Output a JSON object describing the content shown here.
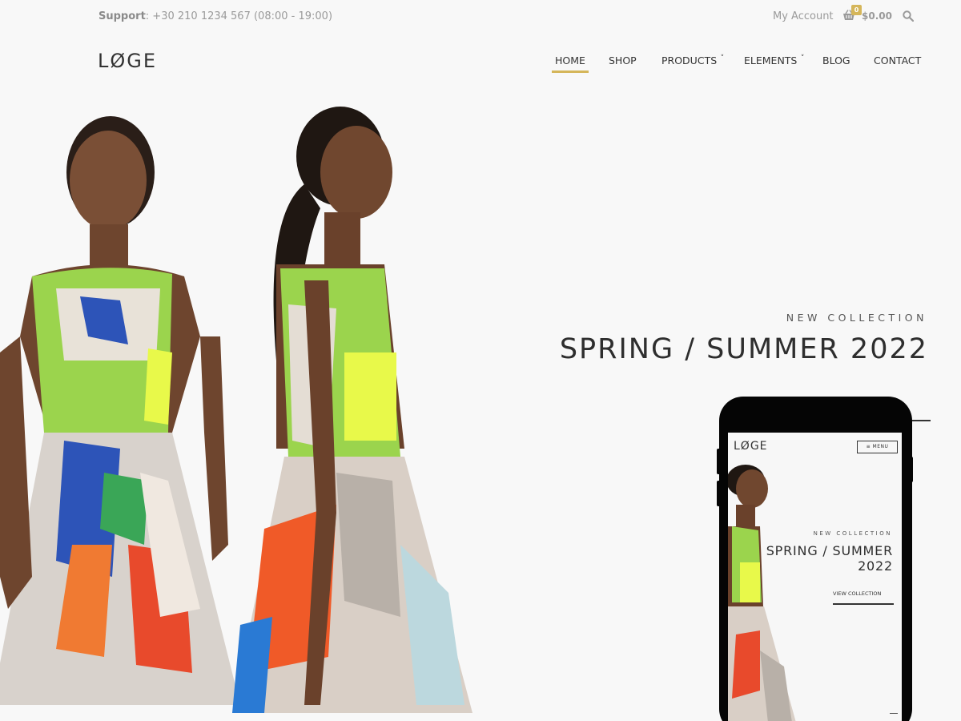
{
  "topbar": {
    "support_label": "Support",
    "support_text": ": +30 210 1234 567 (08:00 - 19:00)",
    "account_label": "My Account",
    "cart_count": "0",
    "cart_total": "$0.00"
  },
  "header": {
    "logo": "LØGE",
    "nav": [
      {
        "label": "HOME",
        "active": true
      },
      {
        "label": "SHOP"
      },
      {
        "label": "PRODUCTS",
        "dropdown": true
      },
      {
        "label": "ELEMENTS",
        "dropdown": true
      },
      {
        "label": "BLOG"
      },
      {
        "label": "CONTACT"
      }
    ]
  },
  "hero": {
    "eyebrow": "NEW COLLECTION",
    "headline": "SPRING / SUMMER 2022"
  },
  "mobile_preview": {
    "logo": "LØGE",
    "menu_label": "≡ MENU",
    "eyebrow": "NEW COLLECTION",
    "headline_line1": "SPRING / SUMMER",
    "headline_line2": "2022",
    "cta": "VIEW COLLECTION"
  },
  "colors": {
    "background": "#f8f8f8",
    "accent": "#d5b65a",
    "text": "#333333",
    "muted": "#9a9a9a"
  },
  "icons": [
    "basket-icon",
    "search-icon",
    "chevron-down-icon",
    "hamburger-icon"
  ]
}
